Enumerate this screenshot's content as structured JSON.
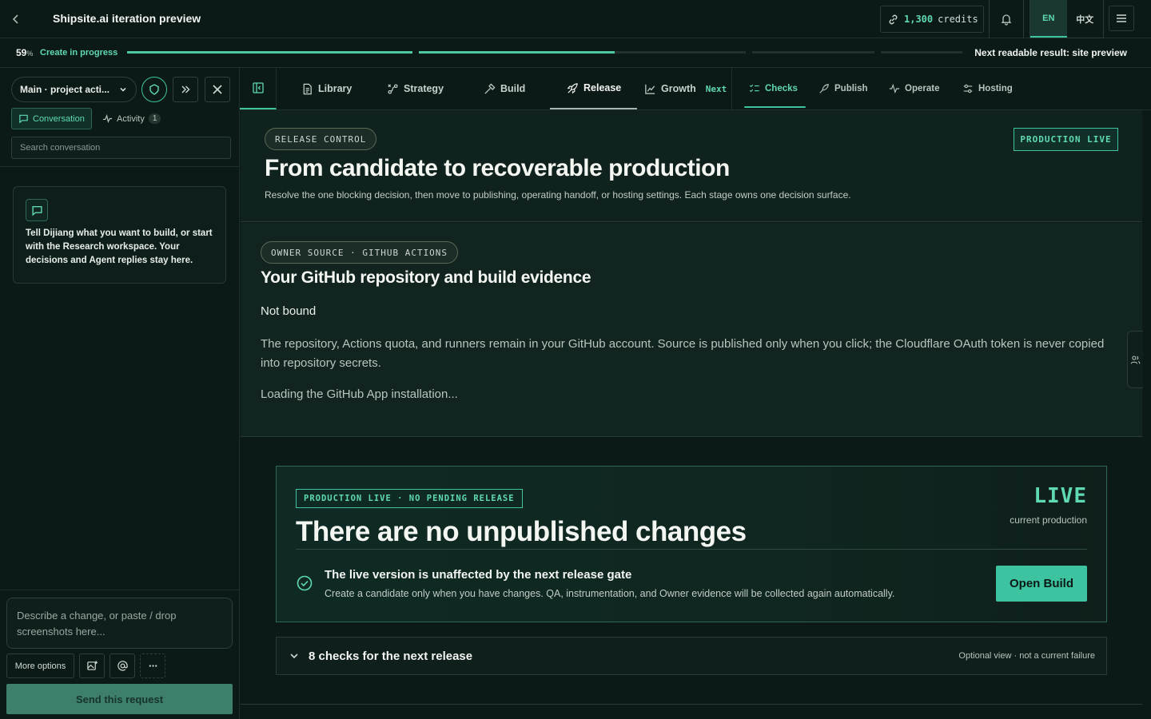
{
  "topbar": {
    "title": "Shipsite.ai iteration preview",
    "credits_value": "1,300",
    "credits_label": "credits",
    "lang_en": "EN",
    "lang_zh": "中文"
  },
  "progress": {
    "percent_value": "59",
    "percent_sign": "%",
    "status": "Create in progress",
    "segments": [
      {
        "fill": 1.0
      },
      {
        "fill": 0.6
      },
      {
        "fill": 0.0
      },
      {
        "fill": 0.0
      }
    ],
    "next_result": "Next readable result: site preview"
  },
  "sidebar": {
    "project_select": "Main · project acti...",
    "tab_conversation": "Conversation",
    "tab_activity": "Activity",
    "activity_count": "1",
    "search_placeholder": "Search conversation",
    "empty_text": "Tell Dijiang what you want to build, or start with the Research workspace. Your decisions and Agent replies stay here.",
    "composer_placeholder": "Describe a change, or paste / drop screenshots here...",
    "more_options": "More options",
    "send_label": "Send this request"
  },
  "nav": {
    "items": [
      {
        "label": "Library",
        "icon": "document-icon"
      },
      {
        "label": "Strategy",
        "icon": "strategy-icon"
      },
      {
        "label": "Build",
        "icon": "hammer-icon"
      },
      {
        "label": "Release",
        "icon": "rocket-icon"
      },
      {
        "label": "Growth",
        "icon": "chart-line-icon"
      }
    ],
    "next_badge": "Next",
    "subitems": [
      {
        "label": "Checks",
        "icon": "checklist-icon"
      },
      {
        "label": "Publish",
        "icon": "rocket-icon"
      },
      {
        "label": "Operate",
        "icon": "pulse-icon"
      },
      {
        "label": "Hosting",
        "icon": "sliders-icon"
      }
    ]
  },
  "hero": {
    "eyebrow": "RELEASE CONTROL",
    "title": "From candidate to recoverable production",
    "subtitle": "Resolve the one blocking decision, then move to publishing, operating handoff, or hosting settings. Each stage owns one decision surface.",
    "status_tag": "PRODUCTION LIVE"
  },
  "github": {
    "eyebrow": "OWNER SOURCE · GITHUB ACTIONS",
    "title": "Your GitHub repository and build evidence",
    "status": "Not bound",
    "description": "The repository, Actions quota, and runners remain in your GitHub account. Source is published only when you click; the Cloudflare OAuth token is never copied into repository secrets.",
    "loading": "Loading the GitHub App installation..."
  },
  "live_card": {
    "tag": "PRODUCTION LIVE · NO PENDING RELEASE",
    "title": "There are no unpublished changes",
    "big_status": "LIVE",
    "small_status": "current production",
    "gate_title": "The live version is unaffected by the next release gate",
    "gate_desc": "Create a candidate only when you have changes. QA, instrumentation, and Owner evidence will be collected again automatically.",
    "button": "Open Build"
  },
  "checks": {
    "title": "8 checks for the next release",
    "note": "Optional view · not a current failure"
  },
  "colors": {
    "background": "#0c1a17",
    "accent": "#3ec3a0",
    "accent_text": "#5fd9b4",
    "text": "#e8efe9"
  }
}
